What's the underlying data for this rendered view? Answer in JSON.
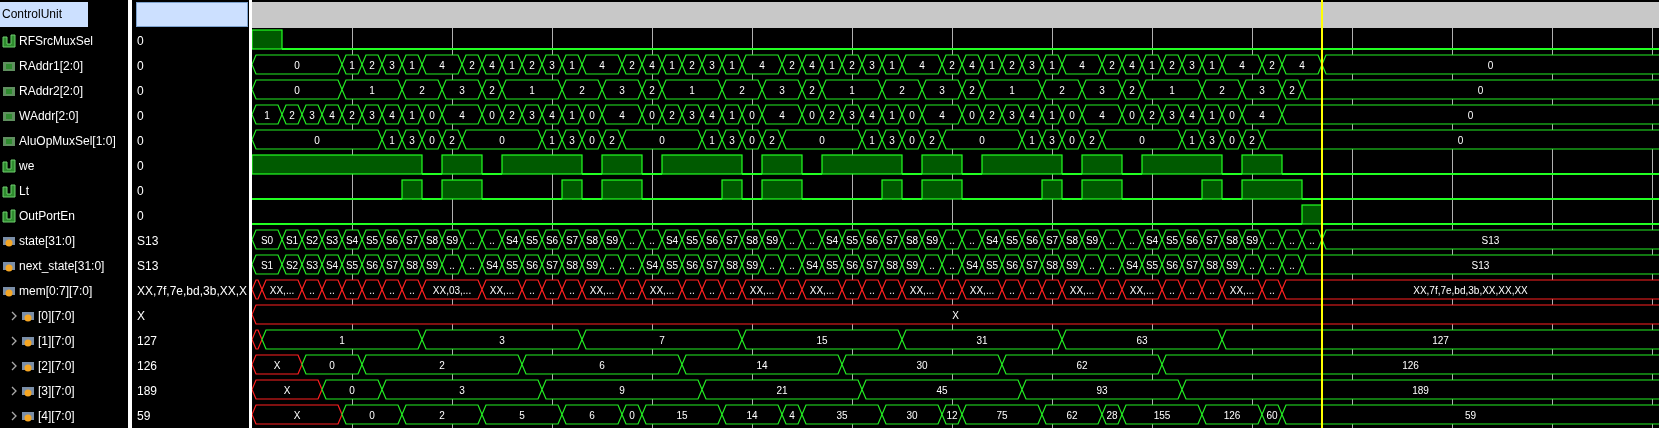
{
  "scope": {
    "name": "ControlUnit"
  },
  "signals": [
    {
      "name": "RFSrcMuxSel",
      "kind": "bit",
      "value": "0",
      "wave": [
        {
          "high": true
        },
        {
          "high": false
        }
      ]
    },
    {
      "name": "RAddr1[2:0]",
      "kind": "bus",
      "value": "0",
      "wave": [
        {
          "value": "0",
          "unknown": false
        },
        {
          "value": "1",
          "unknown": false
        },
        {
          "value": "2",
          "unknown": false
        },
        {
          "value": "3",
          "unknown": false
        },
        {
          "value": "1",
          "unknown": false
        },
        {
          "value": "4",
          "unknown": false
        },
        {
          "value": "2",
          "unknown": false
        },
        {
          "value": "4",
          "unknown": false
        },
        {
          "value": "1",
          "unknown": false
        },
        {
          "value": "2",
          "unknown": false
        },
        {
          "value": "3",
          "unknown": false
        },
        {
          "value": "1",
          "unknown": false
        },
        {
          "value": "4",
          "unknown": false
        },
        {
          "value": "2",
          "unknown": false
        },
        {
          "value": "4",
          "unknown": false
        },
        {
          "value": "1",
          "unknown": false
        },
        {
          "value": "2",
          "unknown": false
        },
        {
          "value": "3",
          "unknown": false
        },
        {
          "value": "1",
          "unknown": false
        },
        {
          "value": "4",
          "unknown": false
        },
        {
          "value": "2",
          "unknown": false
        },
        {
          "value": "4",
          "unknown": false
        },
        {
          "value": "1",
          "unknown": false
        },
        {
          "value": "2",
          "unknown": false
        },
        {
          "value": "3",
          "unknown": false
        },
        {
          "value": "1",
          "unknown": false
        },
        {
          "value": "4",
          "unknown": false
        },
        {
          "value": "2",
          "unknown": false
        },
        {
          "value": "4",
          "unknown": false
        },
        {
          "value": "1",
          "unknown": false
        },
        {
          "value": "2",
          "unknown": false
        },
        {
          "value": "3",
          "unknown": false
        },
        {
          "value": "1",
          "unknown": false
        },
        {
          "value": "4",
          "unknown": false
        },
        {
          "value": "2",
          "unknown": false
        },
        {
          "value": "4",
          "unknown": false
        },
        {
          "value": "1",
          "unknown": false
        },
        {
          "value": "2",
          "unknown": false
        },
        {
          "value": "3",
          "unknown": false
        },
        {
          "value": "1",
          "unknown": false
        },
        {
          "value": "4",
          "unknown": false
        },
        {
          "value": "2",
          "unknown": false
        },
        {
          "value": "4",
          "unknown": false
        },
        {
          "value": "0",
          "unknown": false
        }
      ]
    },
    {
      "name": "RAddr2[2:0]",
      "kind": "bus",
      "value": "0",
      "wave": [
        {
          "value": "0",
          "unknown": false
        },
        {
          "value": "1",
          "unknown": false
        },
        {
          "value": "2",
          "unknown": false
        },
        {
          "value": "3",
          "unknown": false
        },
        {
          "value": "2",
          "unknown": false
        },
        {
          "value": "1",
          "unknown": false
        },
        {
          "value": "2",
          "unknown": false
        },
        {
          "value": "3",
          "unknown": false
        },
        {
          "value": "2",
          "unknown": false
        },
        {
          "value": "1",
          "unknown": false
        },
        {
          "value": "2",
          "unknown": false
        },
        {
          "value": "3",
          "unknown": false
        },
        {
          "value": "2",
          "unknown": false
        },
        {
          "value": "1",
          "unknown": false
        },
        {
          "value": "2",
          "unknown": false
        },
        {
          "value": "3",
          "unknown": false
        },
        {
          "value": "2",
          "unknown": false
        },
        {
          "value": "1",
          "unknown": false
        },
        {
          "value": "2",
          "unknown": false
        },
        {
          "value": "3",
          "unknown": false
        },
        {
          "value": "2",
          "unknown": false
        },
        {
          "value": "1",
          "unknown": false
        },
        {
          "value": "2",
          "unknown": false
        },
        {
          "value": "3",
          "unknown": false
        },
        {
          "value": "2",
          "unknown": false
        },
        {
          "value": "0",
          "unknown": false
        }
      ]
    },
    {
      "name": "WAddr[2:0]",
      "kind": "bus",
      "value": "0",
      "wave": [
        {
          "value": "1",
          "unknown": false
        },
        {
          "value": "2",
          "unknown": false
        },
        {
          "value": "3",
          "unknown": false
        },
        {
          "value": "4",
          "unknown": false
        },
        {
          "value": "2",
          "unknown": false
        },
        {
          "value": "3",
          "unknown": false
        },
        {
          "value": "4",
          "unknown": false
        },
        {
          "value": "1",
          "unknown": false
        },
        {
          "value": "0",
          "unknown": false
        },
        {
          "value": "4",
          "unknown": false
        },
        {
          "value": "0",
          "unknown": false
        },
        {
          "value": "2",
          "unknown": false
        },
        {
          "value": "3",
          "unknown": false
        },
        {
          "value": "4",
          "unknown": false
        },
        {
          "value": "1",
          "unknown": false
        },
        {
          "value": "0",
          "unknown": false
        },
        {
          "value": "4",
          "unknown": false
        },
        {
          "value": "0",
          "unknown": false
        },
        {
          "value": "2",
          "unknown": false
        },
        {
          "value": "3",
          "unknown": false
        },
        {
          "value": "4",
          "unknown": false
        },
        {
          "value": "1",
          "unknown": false
        },
        {
          "value": "0",
          "unknown": false
        },
        {
          "value": "4",
          "unknown": false
        },
        {
          "value": "0",
          "unknown": false
        },
        {
          "value": "2",
          "unknown": false
        },
        {
          "value": "3",
          "unknown": false
        },
        {
          "value": "4",
          "unknown": false
        },
        {
          "value": "1",
          "unknown": false
        },
        {
          "value": "0",
          "unknown": false
        },
        {
          "value": "4",
          "unknown": false
        },
        {
          "value": "0",
          "unknown": false
        },
        {
          "value": "2",
          "unknown": false
        },
        {
          "value": "3",
          "unknown": false
        },
        {
          "value": "4",
          "unknown": false
        },
        {
          "value": "1",
          "unknown": false
        },
        {
          "value": "0",
          "unknown": false
        },
        {
          "value": "4",
          "unknown": false
        },
        {
          "value": "0",
          "unknown": false
        },
        {
          "value": "2",
          "unknown": false
        },
        {
          "value": "3",
          "unknown": false
        },
        {
          "value": "4",
          "unknown": false
        },
        {
          "value": "1",
          "unknown": false
        },
        {
          "value": "0",
          "unknown": false
        },
        {
          "value": "4",
          "unknown": false
        },
        {
          "value": "0",
          "unknown": false
        }
      ]
    },
    {
      "name": "AluOpMuxSel[1:0]",
      "kind": "bus",
      "value": "0",
      "wave": [
        {
          "value": "0",
          "unknown": false
        },
        {
          "value": "1",
          "unknown": false
        },
        {
          "value": "3",
          "unknown": false
        },
        {
          "value": "0",
          "unknown": false
        },
        {
          "value": "2",
          "unknown": false
        },
        {
          "value": "0",
          "unknown": false
        },
        {
          "value": "1",
          "unknown": false
        },
        {
          "value": "3",
          "unknown": false
        },
        {
          "value": "0",
          "unknown": false
        },
        {
          "value": "2",
          "unknown": false
        },
        {
          "value": "0",
          "unknown": false
        },
        {
          "value": "1",
          "unknown": false
        },
        {
          "value": "3",
          "unknown": false
        },
        {
          "value": "0",
          "unknown": false
        },
        {
          "value": "2",
          "unknown": false
        },
        {
          "value": "0",
          "unknown": false
        },
        {
          "value": "1",
          "unknown": false
        },
        {
          "value": "3",
          "unknown": false
        },
        {
          "value": "0",
          "unknown": false
        },
        {
          "value": "2",
          "unknown": false
        },
        {
          "value": "0",
          "unknown": false
        },
        {
          "value": "1",
          "unknown": false
        },
        {
          "value": "3",
          "unknown": false
        },
        {
          "value": "0",
          "unknown": false
        },
        {
          "value": "2",
          "unknown": false
        },
        {
          "value": "0",
          "unknown": false
        },
        {
          "value": "1",
          "unknown": false
        },
        {
          "value": "3",
          "unknown": false
        },
        {
          "value": "0",
          "unknown": false
        },
        {
          "value": "2",
          "unknown": false
        },
        {
          "value": "0",
          "unknown": false
        }
      ]
    },
    {
      "name": "we",
      "kind": "bit",
      "value": "0",
      "wave": [
        {
          "high": true
        },
        {
          "high": false
        },
        {
          "high": true
        },
        {
          "high": false
        },
        {
          "high": true
        },
        {
          "high": false
        },
        {
          "high": true
        },
        {
          "high": false
        },
        {
          "high": true
        },
        {
          "high": false
        },
        {
          "high": true
        },
        {
          "high": false
        },
        {
          "high": true
        },
        {
          "high": false
        },
        {
          "high": true
        },
        {
          "high": false
        },
        {
          "high": true
        },
        {
          "high": false
        },
        {
          "high": true
        },
        {
          "high": false
        },
        {
          "high": true
        },
        {
          "high": false
        },
        {
          "high": true
        },
        {
          "high": false
        }
      ]
    },
    {
      "name": "Lt",
      "kind": "bit",
      "value": "0",
      "wave": [
        {
          "high": false
        },
        {
          "high": true
        },
        {
          "high": false
        },
        {
          "high": true
        },
        {
          "high": false
        },
        {
          "high": true
        },
        {
          "high": false
        },
        {
          "high": true
        },
        {
          "high": false
        },
        {
          "high": true
        },
        {
          "high": false
        },
        {
          "high": true
        },
        {
          "high": false
        },
        {
          "high": true
        },
        {
          "high": false
        },
        {
          "high": true
        },
        {
          "high": false
        },
        {
          "high": true
        },
        {
          "high": false
        },
        {
          "high": true
        },
        {
          "high": false
        },
        {
          "high": true
        },
        {
          "high": false
        },
        {
          "high": true
        },
        {
          "high": false
        }
      ]
    },
    {
      "name": "OutPortEn",
      "kind": "bit",
      "value": "0",
      "wave": [
        {
          "high": false
        },
        {
          "high": true
        },
        {
          "high": false
        }
      ]
    },
    {
      "name": "state[31:0]",
      "kind": "enum",
      "value": "S13",
      "wave": [
        {
          "value": "S0",
          "unknown": false
        },
        {
          "value": "S1",
          "unknown": false
        },
        {
          "value": "S2",
          "unknown": false
        },
        {
          "value": "S3",
          "unknown": false
        },
        {
          "value": "S4",
          "unknown": false
        },
        {
          "value": "S5",
          "unknown": false
        },
        {
          "value": "S6",
          "unknown": false
        },
        {
          "value": "S7",
          "unknown": false
        },
        {
          "value": "S8",
          "unknown": false
        },
        {
          "value": "S9",
          "unknown": false
        },
        {
          "value": "..",
          "unknown": false
        },
        {
          "value": "..",
          "unknown": false
        },
        {
          "value": "S4",
          "unknown": false
        },
        {
          "value": "S5",
          "unknown": false
        },
        {
          "value": "S6",
          "unknown": false
        },
        {
          "value": "S7",
          "unknown": false
        },
        {
          "value": "S8",
          "unknown": false
        },
        {
          "value": "S9",
          "unknown": false
        },
        {
          "value": "..",
          "unknown": false
        },
        {
          "value": "..",
          "unknown": false
        },
        {
          "value": "S4",
          "unknown": false
        },
        {
          "value": "S5",
          "unknown": false
        },
        {
          "value": "S6",
          "unknown": false
        },
        {
          "value": "S7",
          "unknown": false
        },
        {
          "value": "S8",
          "unknown": false
        },
        {
          "value": "S9",
          "unknown": false
        },
        {
          "value": "..",
          "unknown": false
        },
        {
          "value": "..",
          "unknown": false
        },
        {
          "value": "S4",
          "unknown": false
        },
        {
          "value": "S5",
          "unknown": false
        },
        {
          "value": "S6",
          "unknown": false
        },
        {
          "value": "S7",
          "unknown": false
        },
        {
          "value": "S8",
          "unknown": false
        },
        {
          "value": "S9",
          "unknown": false
        },
        {
          "value": "..",
          "unknown": false
        },
        {
          "value": "..",
          "unknown": false
        },
        {
          "value": "S4",
          "unknown": false
        },
        {
          "value": "S5",
          "unknown": false
        },
        {
          "value": "S6",
          "unknown": false
        },
        {
          "value": "S7",
          "unknown": false
        },
        {
          "value": "S8",
          "unknown": false
        },
        {
          "value": "S9",
          "unknown": false
        },
        {
          "value": "..",
          "unknown": false
        },
        {
          "value": "..",
          "unknown": false
        },
        {
          "value": "S4",
          "unknown": false
        },
        {
          "value": "S5",
          "unknown": false
        },
        {
          "value": "S6",
          "unknown": false
        },
        {
          "value": "S7",
          "unknown": false
        },
        {
          "value": "S8",
          "unknown": false
        },
        {
          "value": "S9",
          "unknown": false
        },
        {
          "value": "..",
          "unknown": false
        },
        {
          "value": "..",
          "unknown": false
        },
        {
          "value": "..",
          "unknown": false
        },
        {
          "value": "S13",
          "unknown": false
        }
      ]
    },
    {
      "name": "next_state[31:0]",
      "kind": "enum",
      "value": "S13",
      "wave": [
        {
          "value": "S1",
          "unknown": false
        },
        {
          "value": "S2",
          "unknown": false
        },
        {
          "value": "S3",
          "unknown": false
        },
        {
          "value": "S4",
          "unknown": false
        },
        {
          "value": "S5",
          "unknown": false
        },
        {
          "value": "S6",
          "unknown": false
        },
        {
          "value": "S7",
          "unknown": false
        },
        {
          "value": "S8",
          "unknown": false
        },
        {
          "value": "S9",
          "unknown": false
        },
        {
          "value": "..",
          "unknown": false
        },
        {
          "value": "..",
          "unknown": false
        },
        {
          "value": "S4",
          "unknown": false
        },
        {
          "value": "S5",
          "unknown": false
        },
        {
          "value": "S6",
          "unknown": false
        },
        {
          "value": "S7",
          "unknown": false
        },
        {
          "value": "S8",
          "unknown": false
        },
        {
          "value": "S9",
          "unknown": false
        },
        {
          "value": "..",
          "unknown": false
        },
        {
          "value": "..",
          "unknown": false
        },
        {
          "value": "S4",
          "unknown": false
        },
        {
          "value": "S5",
          "unknown": false
        },
        {
          "value": "S6",
          "unknown": false
        },
        {
          "value": "S7",
          "unknown": false
        },
        {
          "value": "S8",
          "unknown": false
        },
        {
          "value": "S9",
          "unknown": false
        },
        {
          "value": "..",
          "unknown": false
        },
        {
          "value": "..",
          "unknown": false
        },
        {
          "value": "S4",
          "unknown": false
        },
        {
          "value": "S5",
          "unknown": false
        },
        {
          "value": "S6",
          "unknown": false
        },
        {
          "value": "S7",
          "unknown": false
        },
        {
          "value": "S8",
          "unknown": false
        },
        {
          "value": "S9",
          "unknown": false
        },
        {
          "value": "..",
          "unknown": false
        },
        {
          "value": "..",
          "unknown": false
        },
        {
          "value": "S4",
          "unknown": false
        },
        {
          "value": "S5",
          "unknown": false
        },
        {
          "value": "S6",
          "unknown": false
        },
        {
          "value": "S7",
          "unknown": false
        },
        {
          "value": "S8",
          "unknown": false
        },
        {
          "value": "S9",
          "unknown": false
        },
        {
          "value": "..",
          "unknown": false
        },
        {
          "value": "..",
          "unknown": false
        },
        {
          "value": "S4",
          "unknown": false
        },
        {
          "value": "S5",
          "unknown": false
        },
        {
          "value": "S6",
          "unknown": false
        },
        {
          "value": "S7",
          "unknown": false
        },
        {
          "value": "S8",
          "unknown": false
        },
        {
          "value": "S9",
          "unknown": false
        },
        {
          "value": "..",
          "unknown": false
        },
        {
          "value": "..",
          "unknown": false
        },
        {
          "value": "..",
          "unknown": false
        },
        {
          "value": "S13",
          "unknown": false
        }
      ]
    },
    {
      "name": "mem[0:7][7:0]",
      "kind": "array",
      "value": "XX,7f,7e,bd,3b,XX,X",
      "wave": [
        {
          "unknown": true
        },
        {
          "value": "XX,...",
          "unknown": true
        },
        {
          "value": "..",
          "unknown": true
        },
        {
          "value": "..",
          "unknown": true
        },
        {
          "value": "..",
          "unknown": true
        },
        {
          "value": "..",
          "unknown": true
        },
        {
          "value": "..",
          "unknown": true
        },
        {
          "value": "..",
          "unknown": true
        },
        {
          "value": "XX,03,...",
          "unknown": true
        },
        {
          "value": "XX,...",
          "unknown": true
        },
        {
          "value": "..",
          "unknown": true
        },
        {
          "value": "..",
          "unknown": true
        },
        {
          "value": "..",
          "unknown": true
        },
        {
          "value": "XX,...",
          "unknown": true
        },
        {
          "value": "..",
          "unknown": true
        },
        {
          "value": "XX,...",
          "unknown": true
        },
        {
          "value": "..",
          "unknown": true
        },
        {
          "value": "..",
          "unknown": true
        },
        {
          "value": "..",
          "unknown": true
        },
        {
          "value": "XX,...",
          "unknown": true
        },
        {
          "value": "..",
          "unknown": true
        },
        {
          "value": "XX,...",
          "unknown": true
        },
        {
          "value": "..",
          "unknown": true
        },
        {
          "value": "..",
          "unknown": true
        },
        {
          "value": "..",
          "unknown": true
        },
        {
          "value": "XX,...",
          "unknown": true
        },
        {
          "value": "..",
          "unknown": true
        },
        {
          "value": "XX,...",
          "unknown": true
        },
        {
          "value": "..",
          "unknown": true
        },
        {
          "value": "..",
          "unknown": true
        },
        {
          "value": "..",
          "unknown": true
        },
        {
          "value": "XX,...",
          "unknown": true
        },
        {
          "value": "..",
          "unknown": true
        },
        {
          "value": "XX,...",
          "unknown": true
        },
        {
          "value": "..",
          "unknown": true
        },
        {
          "value": "..",
          "unknown": true
        },
        {
          "value": "..",
          "unknown": true
        },
        {
          "value": "XX,...",
          "unknown": true
        },
        {
          "value": "..",
          "unknown": true
        },
        {
          "value": "XX,7f,7e,bd,3b,XX,XX,XX",
          "unknown": true
        }
      ],
      "children": [
        {
          "name": "[0][7:0]",
          "kind": "array",
          "expanded": false,
          "value": "X",
          "wave": [
            {
              "value": "X",
              "unknown": true
            }
          ]
        },
        {
          "name": "[1][7:0]",
          "kind": "array",
          "expanded": false,
          "value": "127",
          "wave": [
            {
              "unknown": true
            },
            {
              "value": "1",
              "unknown": false
            },
            {
              "value": "3",
              "unknown": false
            },
            {
              "value": "7",
              "unknown": false
            },
            {
              "value": "15",
              "unknown": false
            },
            {
              "value": "31",
              "unknown": false
            },
            {
              "value": "63",
              "unknown": false
            },
            {
              "value": "127",
              "unknown": false
            }
          ]
        },
        {
          "name": "[2][7:0]",
          "kind": "array",
          "expanded": false,
          "value": "126",
          "wave": [
            {
              "value": "X",
              "unknown": true
            },
            {
              "value": "0",
              "unknown": false
            },
            {
              "value": "2",
              "unknown": false
            },
            {
              "value": "6",
              "unknown": false
            },
            {
              "value": "14",
              "unknown": false
            },
            {
              "value": "30",
              "unknown": false
            },
            {
              "value": "62",
              "unknown": false
            },
            {
              "value": "126",
              "unknown": false
            }
          ]
        },
        {
          "name": "[3][7:0]",
          "kind": "array",
          "expanded": false,
          "value": "189",
          "wave": [
            {
              "value": "X",
              "unknown": true
            },
            {
              "value": "0",
              "unknown": false
            },
            {
              "value": "3",
              "unknown": false
            },
            {
              "value": "9",
              "unknown": false
            },
            {
              "value": "21",
              "unknown": false
            },
            {
              "value": "45",
              "unknown": false
            },
            {
              "value": "93",
              "unknown": false
            },
            {
              "value": "189",
              "unknown": false
            }
          ]
        },
        {
          "name": "[4][7:0]",
          "kind": "array",
          "expanded": false,
          "value": "59",
          "wave": [
            {
              "value": "X",
              "unknown": true
            },
            {
              "value": "0",
              "unknown": false
            },
            {
              "value": "2",
              "unknown": false
            },
            {
              "value": "5",
              "unknown": false
            },
            {
              "value": "6",
              "unknown": false
            },
            {
              "value": "0",
              "unknown": false
            },
            {
              "value": "15",
              "unknown": false
            },
            {
              "value": "14",
              "unknown": false
            },
            {
              "value": "4",
              "unknown": false
            },
            {
              "value": "35",
              "unknown": false
            },
            {
              "value": "30",
              "unknown": false
            },
            {
              "value": "12",
              "unknown": false
            },
            {
              "value": "75",
              "unknown": false
            },
            {
              "value": "62",
              "unknown": false
            },
            {
              "value": "28",
              "unknown": false
            },
            {
              "value": "155",
              "unknown": false
            },
            {
              "value": "126",
              "unknown": false
            },
            {
              "value": "60",
              "unknown": false
            },
            {
              "value": "59",
              "unknown": false
            }
          ]
        }
      ]
    }
  ]
}
